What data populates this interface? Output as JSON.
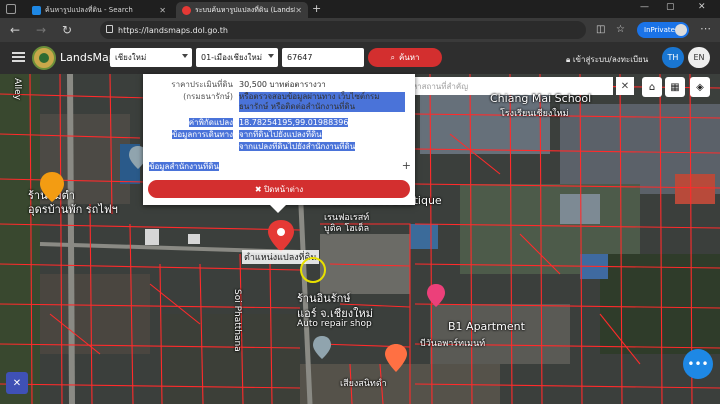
{
  "browser": {
    "tabs": [
      {
        "title": "ค้นหารูปแปลงที่ดิน - Search",
        "active": false
      },
      {
        "title": "ระบบค้นหารูปแปลงที่ดิน (LandsMaps)",
        "active": true
      }
    ],
    "url": "https://landsmaps.dol.go.th",
    "inprivate_label": "InPrivate"
  },
  "app": {
    "brand": "LandsMaps",
    "province": "เชียงใหม่",
    "district": "01-เมืองเชียงใหม่",
    "parcel_number": "67647",
    "search_label": "ค้นหา",
    "login_label": "เข้าสู่ระบบ/ลงทะเบียน",
    "lang_th": "TH",
    "lang_en": "EN"
  },
  "map": {
    "search_placeholder": "ค้นหาสถานที่สำคัญ",
    "marker_label": "ตำแหน่งแปลงที่ดิน",
    "labels": [
      "ร้านส้มตำ",
      "อุดรบ้านพัก รถไฟฯ",
      "Rainforest Boutique",
      "เรนฟอเรสท์",
      "บูติค โฮเต็ล",
      "ร้านอินรักษ์",
      "แอร์ จ.เชียงใหม่",
      "Auto repair shop",
      "B1 Apartment",
      "บีวันอพาร์ทเมนท์",
      "Chiang Mai School",
      "โรงเรียนเชียงใหม่",
      "Alley",
      "Soi Phatthana",
      "เสียงสนิทดำ"
    ]
  },
  "popup": {
    "rows": [
      {
        "label": "ราคาประเมินที่ดิน",
        "value": "30,500 บาทต่อตารางวา"
      },
      {
        "label": "(กรมธนารักษ์)",
        "value": "หรือตรวจสอบข้อมูลผ่านทาง เว็บไซต์กรมธนารักษ์ หรือติดต่อสำนักงานที่ดิน"
      },
      {
        "label": "ค่าพิกัดแปลง",
        "value": "18.78254195,99.01988396"
      },
      {
        "label": "ข้อมูลการเดินทาง",
        "value": "จากที่ดินไปยังแปลงที่ดิน"
      },
      {
        "label": "",
        "value": "จากแปลงที่ดินไปยังสำนักงานที่ดิน"
      }
    ],
    "section_title": "ข้อมูลสำนักงานที่ดิน",
    "close_label": "ปิดหน้าต่าง"
  }
}
